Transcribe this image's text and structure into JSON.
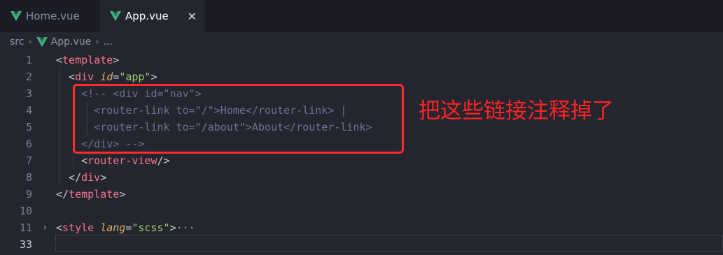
{
  "tabs": [
    {
      "label": "Home.vue",
      "active": false
    },
    {
      "label": "App.vue",
      "active": true,
      "close": "✕"
    }
  ],
  "breadcrumb": {
    "folder": "src",
    "file": "App.vue",
    "more": "..."
  },
  "lines": [
    {
      "num": "1",
      "tokens": [
        {
          "t": "<",
          "c": "punc"
        },
        {
          "t": "template",
          "c": "tag"
        },
        {
          "t": ">",
          "c": "punc"
        }
      ]
    },
    {
      "num": "2",
      "tokens": [
        {
          "t": "  <",
          "c": "punc"
        },
        {
          "t": "div",
          "c": "tag"
        },
        {
          "t": " ",
          "c": "punc"
        },
        {
          "t": "id",
          "c": "attr"
        },
        {
          "t": "=",
          "c": "punc"
        },
        {
          "t": "\"app\"",
          "c": "str"
        },
        {
          "t": ">",
          "c": "punc"
        }
      ]
    },
    {
      "num": "3",
      "tokens": [
        {
          "t": "    <!-- <div id=\"nav\">",
          "c": "cmt"
        }
      ]
    },
    {
      "num": "4",
      "tokens": [
        {
          "t": "      <router-link to=\"/\">Home</router-link> |",
          "c": "cmt"
        }
      ]
    },
    {
      "num": "5",
      "tokens": [
        {
          "t": "      <router-link to=\"/about\">About</router-link>",
          "c": "cmt"
        }
      ]
    },
    {
      "num": "6",
      "tokens": [
        {
          "t": "    </div> -->",
          "c": "cmt"
        }
      ]
    },
    {
      "num": "7",
      "tokens": [
        {
          "t": "    <",
          "c": "punc"
        },
        {
          "t": "router-view",
          "c": "tag"
        },
        {
          "t": "/>",
          "c": "punc"
        }
      ]
    },
    {
      "num": "8",
      "tokens": [
        {
          "t": "  </",
          "c": "punc"
        },
        {
          "t": "div",
          "c": "tag"
        },
        {
          "t": ">",
          "c": "punc"
        }
      ]
    },
    {
      "num": "9",
      "tokens": [
        {
          "t": "</",
          "c": "punc"
        },
        {
          "t": "template",
          "c": "tag"
        },
        {
          "t": ">",
          "c": "punc"
        }
      ]
    },
    {
      "num": "10",
      "tokens": []
    },
    {
      "num": "11",
      "fold": "›",
      "tokens": [
        {
          "t": "<",
          "c": "punc"
        },
        {
          "t": "style",
          "c": "tag"
        },
        {
          "t": " ",
          "c": "punc"
        },
        {
          "t": "lang",
          "c": "attr"
        },
        {
          "t": "=",
          "c": "punc"
        },
        {
          "t": "\"scss\"",
          "c": "str"
        },
        {
          "t": ">",
          "c": "punc"
        },
        {
          "t": "···",
          "c": "dots"
        }
      ]
    },
    {
      "num": "33",
      "current": true,
      "tokens": []
    }
  ],
  "annotation": "把这些链接注释掉了",
  "colors": {
    "annotation": "#ff2323",
    "tag": "#f7768e",
    "attr": "#e0af68",
    "string": "#9ece6a",
    "comment": "#6b7390",
    "vue_logo": "#41b883"
  }
}
